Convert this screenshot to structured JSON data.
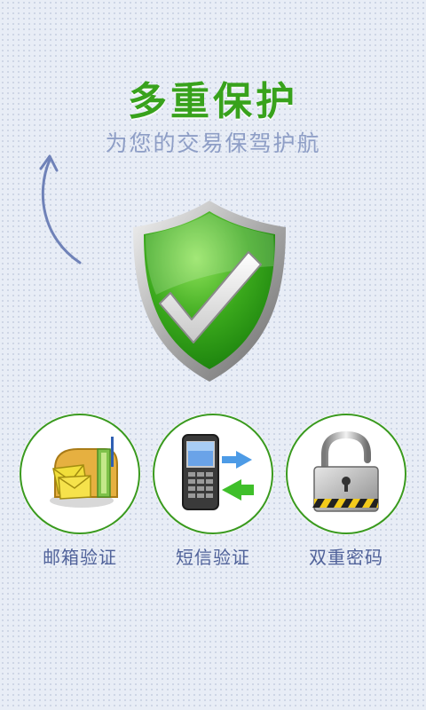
{
  "header": {
    "title": "多重保护",
    "subtitle": "为您的交易保驾护航"
  },
  "features": [
    {
      "label": "邮箱验证",
      "icon": "mailbox-icon"
    },
    {
      "label": "短信验证",
      "icon": "mobile-phone-icon"
    },
    {
      "label": "双重密码",
      "icon": "padlock-icon"
    }
  ],
  "colors": {
    "title_green": "#38a21c",
    "subtitle_blue": "#8e9ec6",
    "label_blue": "#50629a",
    "circle_border": "#3a9a1f"
  }
}
